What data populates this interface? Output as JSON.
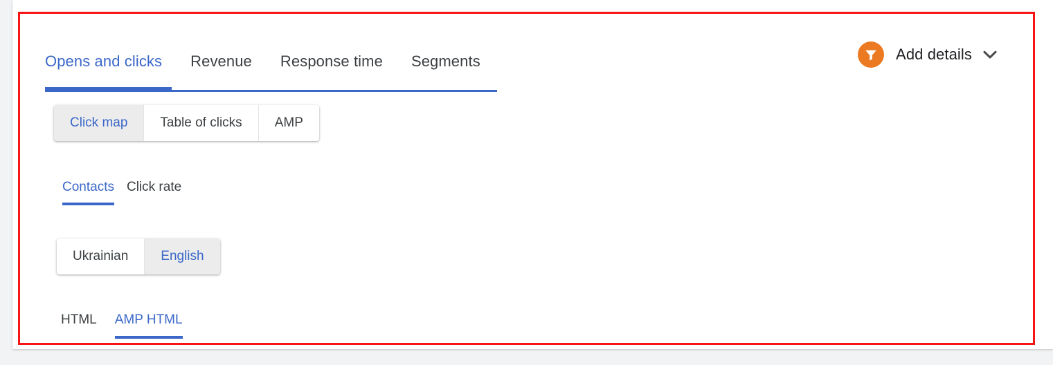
{
  "main_tabs": [
    {
      "label": "Opens and clicks",
      "active": true
    },
    {
      "label": "Revenue",
      "active": false
    },
    {
      "label": "Response time",
      "active": false
    },
    {
      "label": "Segments",
      "active": false
    }
  ],
  "add_details": {
    "label": "Add details",
    "icon": "funnel-icon",
    "chevron_icon": "chevron-down-icon",
    "badge_color": "#ec7a22"
  },
  "view_modes": [
    {
      "label": "Click map",
      "selected": true
    },
    {
      "label": "Table of clicks",
      "selected": false
    },
    {
      "label": "AMP",
      "selected": false
    }
  ],
  "sub_tabs": [
    {
      "label": "Contacts",
      "active": true
    },
    {
      "label": "Click rate",
      "active": false
    }
  ],
  "languages": [
    {
      "label": "Ukrainian",
      "selected": false
    },
    {
      "label": "English",
      "selected": true
    }
  ],
  "format_tabs": [
    {
      "label": "HTML",
      "active": false
    },
    {
      "label": "AMP HTML",
      "active": true
    }
  ],
  "colors": {
    "accent_blue": "#3b68c8",
    "highlight_red": "#f71414",
    "orange": "#ec7a22",
    "text_primary": "#3c4043",
    "selected_segment_bg": "#ececec"
  }
}
